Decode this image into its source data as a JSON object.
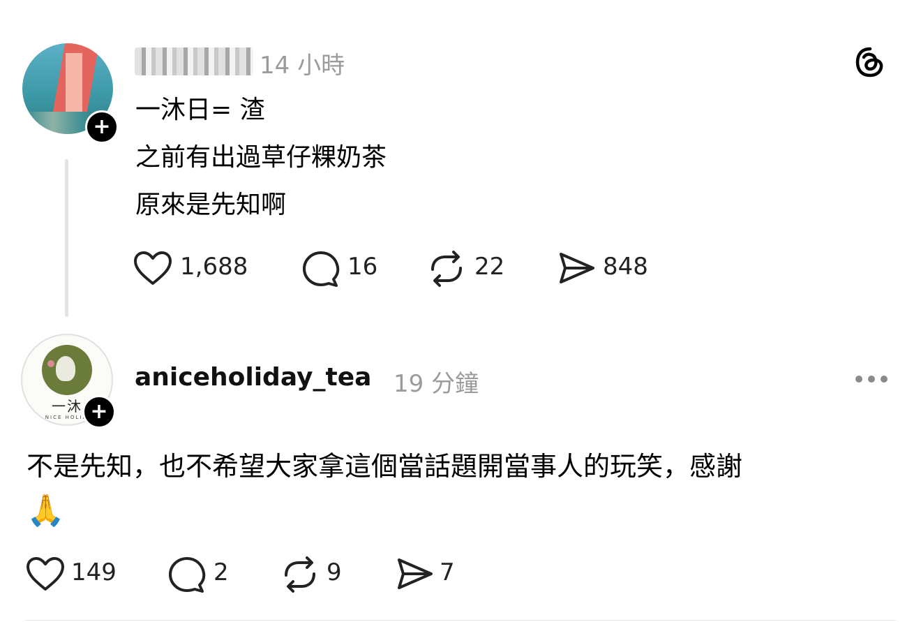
{
  "post1": {
    "timestamp": "14 小時",
    "lines": [
      "一沐日= 渣",
      "之前有出過草仔粿奶茶",
      "原來是先知啊"
    ],
    "stats": {
      "likes": "1,688",
      "comments": "16",
      "reposts": "22",
      "shares": "848"
    }
  },
  "post2": {
    "username": "aniceholiday_tea",
    "timestamp": "19 分鐘",
    "avatar_text": "一沐",
    "avatar_subtext": "A NICE HOLIDAY",
    "lines": [
      "不是先知，也不希望大家拿這個當話題開當事人的玩笑，感謝",
      "🙏"
    ],
    "stats": {
      "likes": "149",
      "comments": "2",
      "reposts": "9",
      "shares": "7"
    }
  },
  "icons": {
    "logo": "threads-logo-icon",
    "follow": "plus-icon",
    "more": "more-options-icon",
    "like": "heart-icon",
    "comment": "comment-icon",
    "repost": "repost-icon",
    "share": "send-icon"
  }
}
